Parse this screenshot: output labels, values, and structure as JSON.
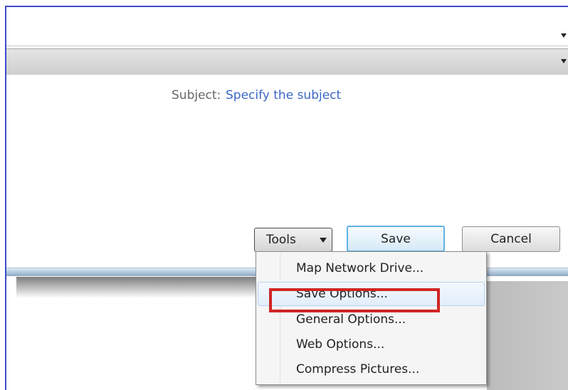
{
  "subject": {
    "label": "Subject:",
    "value": "Specify the subject"
  },
  "buttons": {
    "tools": "Tools",
    "save": "Save",
    "cancel": "Cancel"
  },
  "tools_menu": {
    "items": [
      {
        "label": "Map Network Drive..."
      },
      {
        "label": "Save Options...",
        "highlighted": true
      },
      {
        "label": "General Options..."
      },
      {
        "label": "Web Options..."
      },
      {
        "label": "Compress Pictures..."
      }
    ]
  },
  "colors": {
    "frame_border": "#3e4ad0",
    "subject_value": "#3a67c6",
    "highlight_box": "#d02525",
    "save_button_border": "#5eb3e4"
  }
}
